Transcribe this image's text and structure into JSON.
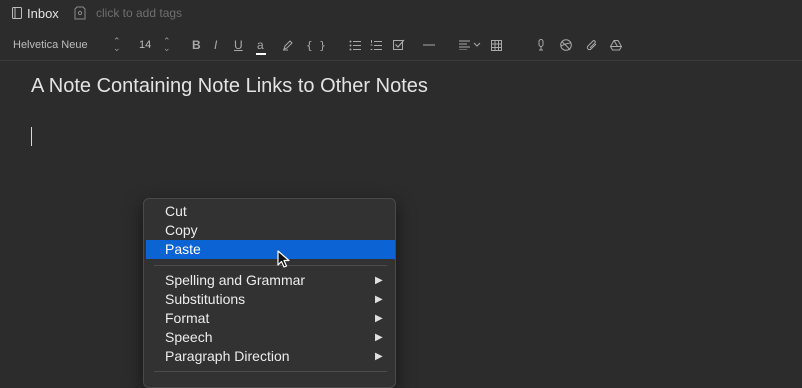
{
  "header": {
    "notebook_icon": "notebook-icon",
    "notebook": "Inbox",
    "tag_icon": "tag-icon",
    "tag_placeholder": "click to add tags"
  },
  "toolbar": {
    "font_family": "Helvetica Neue",
    "font_size": "14",
    "bold": "B",
    "italic": "I",
    "underline": "U",
    "text_color": "a",
    "code": "{ }",
    "icons": [
      "bold-icon",
      "italic-icon",
      "underline-icon",
      "text-color-icon",
      "highlight-icon",
      "code-icon",
      "bulleted-list-icon",
      "numbered-list-icon",
      "checklist-icon",
      "horizontal-rule-icon",
      "align-icon",
      "table-icon",
      "audio-icon",
      "dribbble-icon",
      "attachment-icon",
      "drive-icon"
    ],
    "accent_color": "#0b63d4"
  },
  "note": {
    "title": "A Note Containing Note Links to Other Notes"
  },
  "context_menu": {
    "items": [
      {
        "label": "Cut"
      },
      {
        "label": "Copy"
      },
      {
        "label": "Paste",
        "selected": true
      },
      {
        "label": "Spelling and Grammar",
        "submenu": true
      },
      {
        "label": "Substitutions",
        "submenu": true
      },
      {
        "label": "Format",
        "submenu": true
      },
      {
        "label": "Speech",
        "submenu": true
      },
      {
        "label": "Paragraph Direction",
        "submenu": true
      }
    ],
    "submenu_glyph": "▶"
  }
}
